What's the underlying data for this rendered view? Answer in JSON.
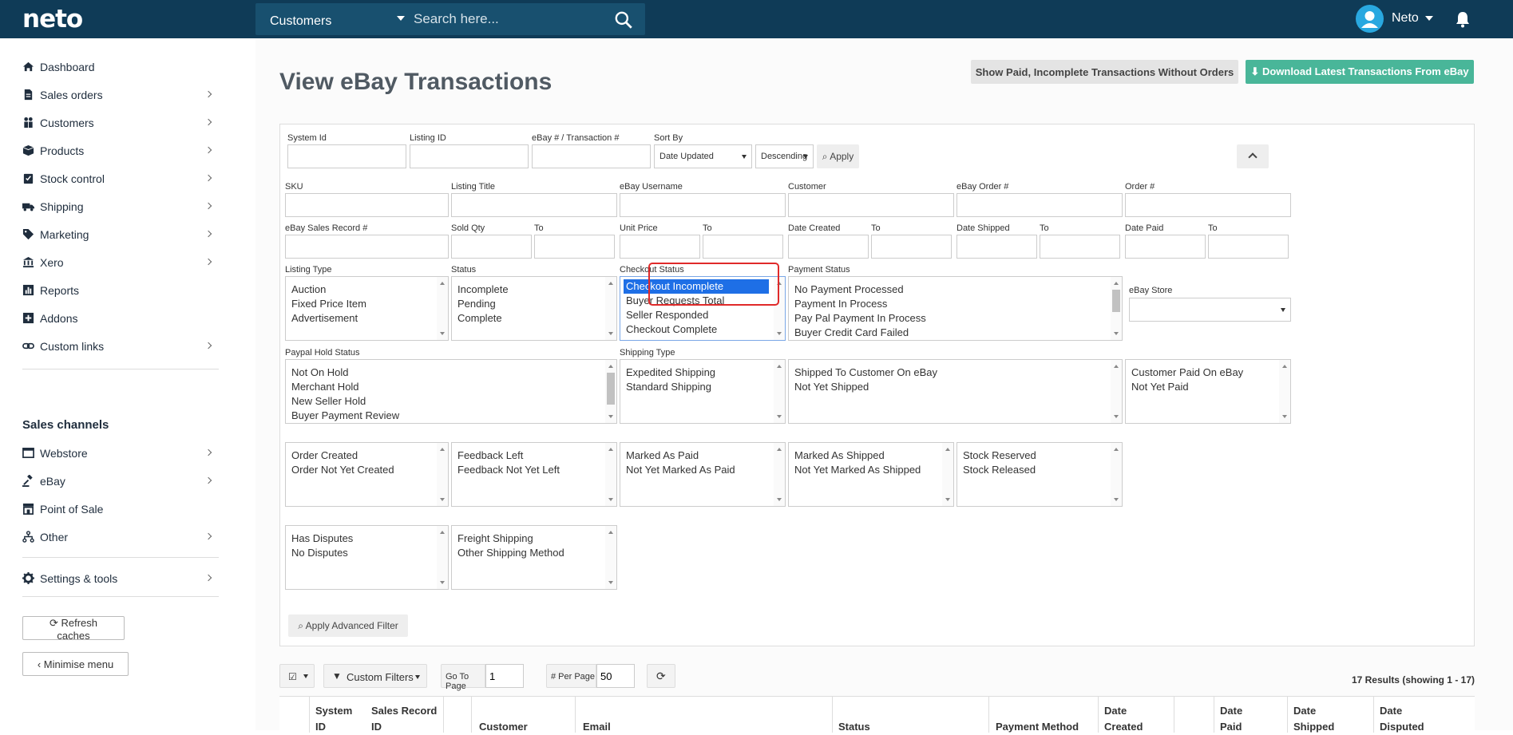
{
  "topbar": {
    "logo": "neto",
    "search_scope": "Customers",
    "search_placeholder": "Search here...",
    "user_name": "Neto"
  },
  "sidebar": {
    "items": [
      {
        "label": "Dashboard",
        "icon": "home-icon"
      },
      {
        "label": "Sales orders",
        "icon": "document-icon"
      },
      {
        "label": "Customers",
        "icon": "users-icon"
      },
      {
        "label": "Products",
        "icon": "box-icon"
      },
      {
        "label": "Stock control",
        "icon": "clipboard-icon"
      },
      {
        "label": "Shipping",
        "icon": "truck-icon"
      },
      {
        "label": "Marketing",
        "icon": "tag-icon"
      },
      {
        "label": "Xero",
        "icon": "bank-icon"
      },
      {
        "label": "Reports",
        "icon": "bar-chart-icon"
      },
      {
        "label": "Addons",
        "icon": "plus-square-icon"
      },
      {
        "label": "Custom links",
        "icon": "link-icon"
      }
    ],
    "sales_channels_heading": "Sales channels",
    "channels": [
      {
        "label": "Webstore",
        "icon": "window-icon"
      },
      {
        "label": "eBay",
        "icon": "gavel-icon"
      },
      {
        "label": "Point of Sale",
        "icon": "store-icon"
      },
      {
        "label": "Other",
        "icon": "sitemap-icon"
      }
    ],
    "settings_label": "Settings & tools",
    "refresh_caches": "Refresh caches",
    "minimise_menu": "Minimise menu"
  },
  "page": {
    "title": "View eBay Transactions",
    "btn_show_paid": "Show Paid, Incomplete Transactions Without Orders",
    "btn_download": "Download Latest Transactions From eBay"
  },
  "filters": {
    "system_id": "System Id",
    "listing_id": "Listing ID",
    "ebay_transaction": "eBay # / Transaction #",
    "sort_by": "Sort By",
    "sort_by_value": "Date Updated",
    "sort_dir_value": "Descending",
    "apply": "Apply",
    "sku": "SKU",
    "listing_title": "Listing Title",
    "ebay_username": "eBay Username",
    "customer": "Customer",
    "ebay_order": "eBay Order #",
    "order_num": "Order #",
    "ebay_sales_record": "eBay Sales Record #",
    "sold_qty": "Sold Qty",
    "to": "To",
    "unit_price": "Unit Price",
    "date_created": "Date Created",
    "date_shipped": "Date Shipped",
    "date_paid": "Date Paid",
    "listing_type": "Listing Type",
    "status": "Status",
    "checkout_status": "Checkout Status",
    "payment_status": "Payment Status",
    "ebay_store": "eBay Store",
    "paypal_hold_status": "Paypal Hold Status",
    "shipping_type": "Shipping Type",
    "apply_advanced": "Apply Advanced Filter",
    "listing_type_opts": [
      "Auction",
      "Fixed Price Item",
      "Advertisement"
    ],
    "status_opts": [
      "Incomplete",
      "Pending",
      "Complete"
    ],
    "checkout_opts": [
      "Checkout Incomplete",
      "Buyer Requests Total",
      "Seller Responded",
      "Checkout Complete"
    ],
    "payment_opts": [
      "No Payment Processed",
      "Payment In Process",
      "Pay Pal Payment In Process",
      "Buyer Credit Card Failed"
    ],
    "paypal_opts": [
      "Not On Hold",
      "Merchant Hold",
      "New Seller Hold",
      "Buyer Payment Review"
    ],
    "shipping_type_opts": [
      "Expedited Shipping",
      "Standard Shipping"
    ],
    "shipped_opts": [
      "Shipped To Customer On eBay",
      "Not Yet Shipped"
    ],
    "customer_paid_opts": [
      "Customer Paid On eBay",
      "Not Yet Paid"
    ],
    "order_created_opts": [
      "Order Created",
      "Order Not Yet Created"
    ],
    "feedback_opts": [
      "Feedback Left",
      "Feedback Not Yet Left"
    ],
    "marked_paid_opts": [
      "Marked As Paid",
      "Not Yet Marked As Paid"
    ],
    "marked_shipped_opts": [
      "Marked As Shipped",
      "Not Yet Marked As Shipped"
    ],
    "stock_opts": [
      "Stock Reserved",
      "Stock Released"
    ],
    "disputes_opts": [
      "Has Disputes",
      "No Disputes"
    ],
    "freight_opts": [
      "Freight Shipping",
      "Other Shipping Method"
    ]
  },
  "toolbar": {
    "custom_filters": "Custom Filters",
    "go_to_page_label": "Go To Page",
    "go_to_page_value": "1",
    "per_page_label": "# Per Page",
    "per_page_value": "50",
    "results": "17 Results (showing 1 - 17)"
  },
  "table": {
    "headers": [
      "System\nID",
      "Sales Record\nID",
      "Customer",
      "Email",
      "Status",
      "Payment Method",
      "Date\nCreated",
      "Date\nPaid",
      "Date\nShipped",
      "Date\nDisputed"
    ]
  },
  "colors": {
    "topbar": "#0f3b57",
    "accent_green": "#49b699",
    "highlight": "#e02a2a",
    "selection": "#1e6fe6"
  }
}
